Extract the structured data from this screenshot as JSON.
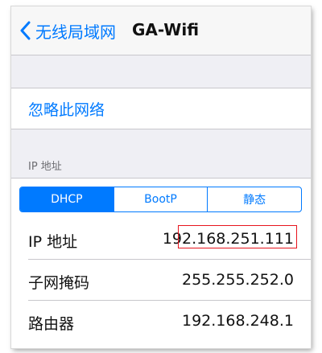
{
  "navbar": {
    "back_label": "无线局域网",
    "title": "GA-Wifi"
  },
  "forget_network": {
    "label": "忽略此网络"
  },
  "ip_section": {
    "header": "IP 地址",
    "segments": [
      {
        "label": "DHCP",
        "selected": true
      },
      {
        "label": "BootP",
        "selected": false
      },
      {
        "label": "静态",
        "selected": false
      }
    ],
    "rows": [
      {
        "label": "IP 地址",
        "value": "192.168.251.111"
      },
      {
        "label": "子网掩码",
        "value": "255.255.252.0"
      },
      {
        "label": "路由器",
        "value": "192.168.248.1"
      }
    ]
  },
  "colors": {
    "accent": "#007aff",
    "highlight_box": "#e8141d",
    "background": "#efeff4"
  }
}
